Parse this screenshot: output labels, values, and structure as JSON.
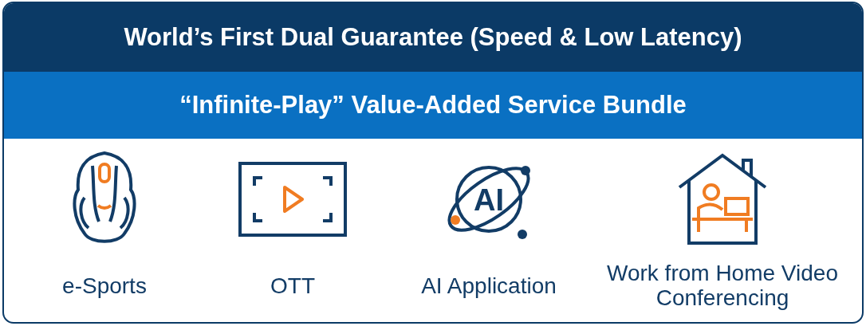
{
  "title": "World’s First Dual Guarantee (Speed & Low Latency)",
  "subtitle": "“Infinite-Play” Value-Added Service Bundle",
  "services": [
    {
      "kind": "mouse",
      "label": "e-Sports"
    },
    {
      "kind": "screen",
      "label": "OTT"
    },
    {
      "kind": "ai",
      "label": "AI Application",
      "icon_text": "AI"
    },
    {
      "kind": "home",
      "label": "Work from Home Video Conferencing"
    }
  ]
}
